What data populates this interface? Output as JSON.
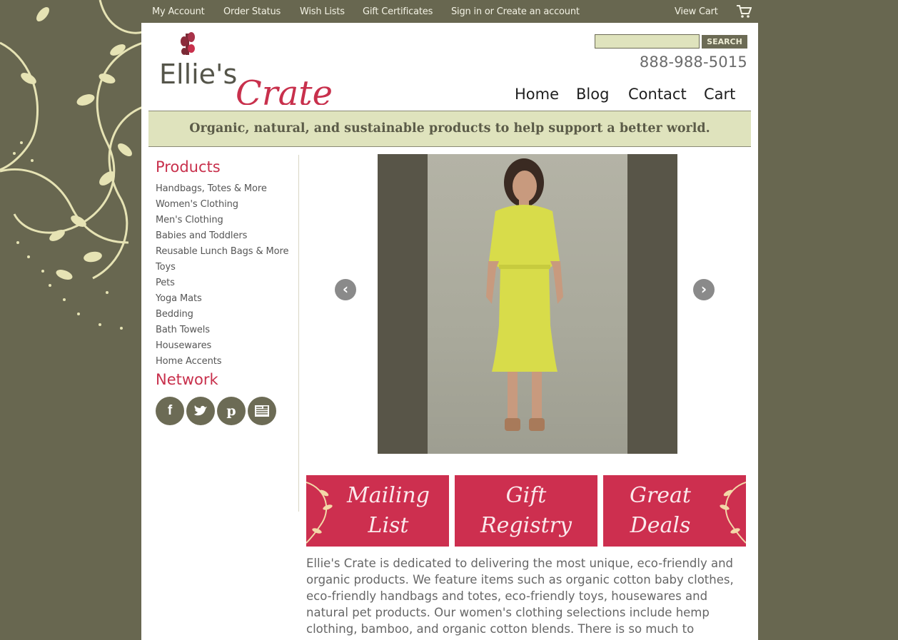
{
  "topbar": {
    "links": [
      "My Account",
      "Order Status",
      "Wish Lists",
      "Gift Certificates",
      "Sign in or Create an account",
      "View Cart"
    ]
  },
  "logo": {
    "first": "Ellie's",
    "second": "Crate"
  },
  "search": {
    "value": "",
    "button": "SEARCH"
  },
  "phone": "888-988-5015",
  "nav": [
    "Home",
    "Blog",
    "Contact",
    "Cart"
  ],
  "tagline": "Organic, natural, and sustainable products to help support a better world.",
  "sidebar": {
    "products_heading": "Products",
    "categories": [
      "Handbags, Totes & More",
      "Women's Clothing",
      "Men's Clothing",
      "Babies and Toddlers",
      "Reusable Lunch Bags & More",
      "Toys",
      "Pets",
      "Yoga Mats",
      "Bedding",
      "Bath Towels",
      "Housewares",
      "Home Accents"
    ],
    "network_heading": "Network"
  },
  "promos": [
    "Mailing\nList",
    "Gift\nRegistry",
    "Great\nDeals"
  ],
  "intro": "Ellie's Crate is dedicated to delivering the most unique, eco-friendly and organic products. We feature items such as organic cotton baby clothes, eco-friendly handbags and totes, eco-friendly toys, housewares and natural pet products. Our women's clothing selections include hemp clothing, bamboo, and organic cotton blends. There is so much to choose",
  "colors": {
    "background": "#686750",
    "accent": "#c8304c",
    "tagline_bg": "#dfe3bd",
    "promo_bg": "#cd2f4f"
  }
}
